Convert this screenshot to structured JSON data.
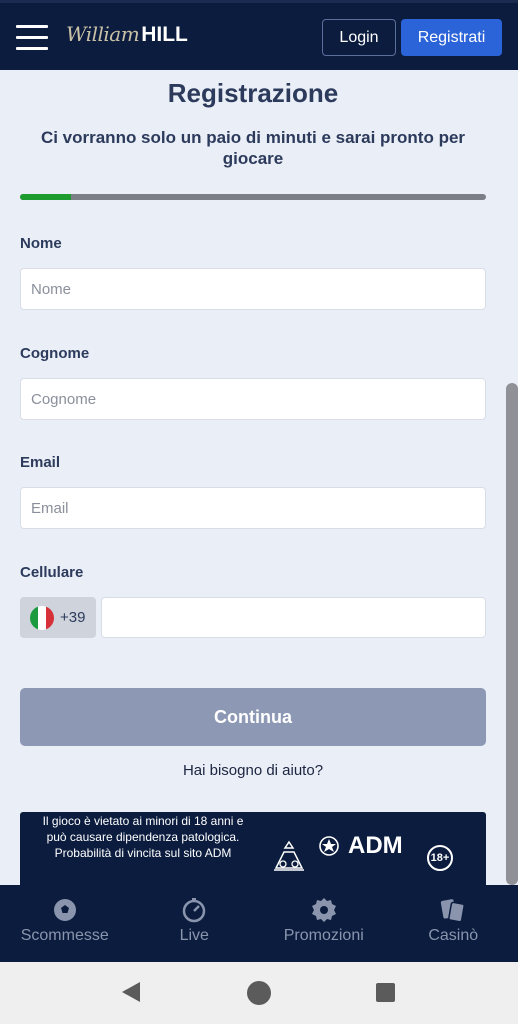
{
  "header": {
    "logo_script": "William",
    "logo_bold": "HILL",
    "login_label": "Login",
    "register_label": "Registrati"
  },
  "form": {
    "title": "Registrazione",
    "subtitle": "Ci vorranno solo un paio di minuti e sarai pronto per giocare",
    "progress_fraction": 0.11,
    "fields": {
      "nome": {
        "label": "Nome",
        "placeholder": "Nome"
      },
      "cognome": {
        "label": "Cognome",
        "placeholder": "Cognome"
      },
      "email": {
        "label": "Email",
        "placeholder": "Email"
      },
      "cellulare": {
        "label": "Cellulare",
        "prefix": "+39",
        "value": ""
      }
    },
    "continue_label": "Continua",
    "help_text": "Hai bisogno di aiuto?"
  },
  "footer": {
    "disclaimer": "Il gioco è vietato ai minori di 18 anni e può causare dipendenza patologica. Probabilità di vincita sul sito ADM",
    "adm_label": "ADM",
    "age_label": "18+"
  },
  "bottom_nav": [
    {
      "label": "Scommesse",
      "icon": "soccer-ball-icon"
    },
    {
      "label": "Live",
      "icon": "stopwatch-icon"
    },
    {
      "label": "Promozioni",
      "icon": "badge-icon"
    },
    {
      "label": "Casinò",
      "icon": "cards-icon"
    }
  ],
  "colors": {
    "header_bg": "#0b1c3e",
    "accent": "#2b63d8",
    "progress": "#1e9b2e",
    "page_bg": "#eaeef6"
  }
}
